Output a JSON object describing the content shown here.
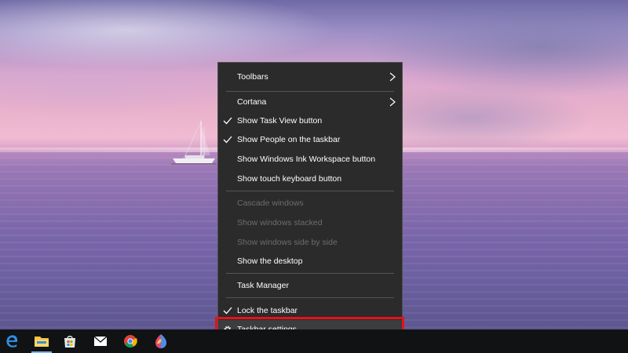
{
  "context_menu": {
    "items": [
      {
        "label": "Toolbars",
        "checked": false,
        "submenu": true,
        "enabled": true
      },
      {
        "label": "Cortana",
        "checked": false,
        "submenu": true,
        "enabled": true
      },
      {
        "label": "Show Task View button",
        "checked": true,
        "submenu": false,
        "enabled": true
      },
      {
        "label": "Show People on the taskbar",
        "checked": true,
        "submenu": false,
        "enabled": true
      },
      {
        "label": "Show Windows Ink Workspace button",
        "checked": false,
        "submenu": false,
        "enabled": true
      },
      {
        "label": "Show touch keyboard button",
        "checked": false,
        "submenu": false,
        "enabled": true
      },
      {
        "label": "Cascade windows",
        "checked": false,
        "submenu": false,
        "enabled": false
      },
      {
        "label": "Show windows stacked",
        "checked": false,
        "submenu": false,
        "enabled": false
      },
      {
        "label": "Show windows side by side",
        "checked": false,
        "submenu": false,
        "enabled": false
      },
      {
        "label": "Show the desktop",
        "checked": false,
        "submenu": false,
        "enabled": true
      },
      {
        "label": "Task Manager",
        "checked": false,
        "submenu": false,
        "enabled": true
      },
      {
        "label": "Lock the taskbar",
        "checked": true,
        "submenu": false,
        "enabled": true
      },
      {
        "label": "Taskbar settings",
        "checked": false,
        "submenu": false,
        "enabled": true,
        "icon": "gear-icon",
        "highlighted": true
      }
    ]
  },
  "taskbar": {
    "apps": [
      {
        "name": "edge-icon"
      },
      {
        "name": "file-explorer-icon",
        "active": true
      },
      {
        "name": "store-icon"
      },
      {
        "name": "mail-icon"
      },
      {
        "name": "chrome-icon"
      },
      {
        "name": "paint3d-icon"
      }
    ]
  },
  "colors": {
    "menu_background": "#2b2b2b",
    "menu_text": "#ffffff",
    "menu_disabled_text": "#6d6d6d",
    "highlight_frame": "#e5121b",
    "taskbar_background": "#101214",
    "taskbar_active_indicator": "#79b8ff"
  }
}
